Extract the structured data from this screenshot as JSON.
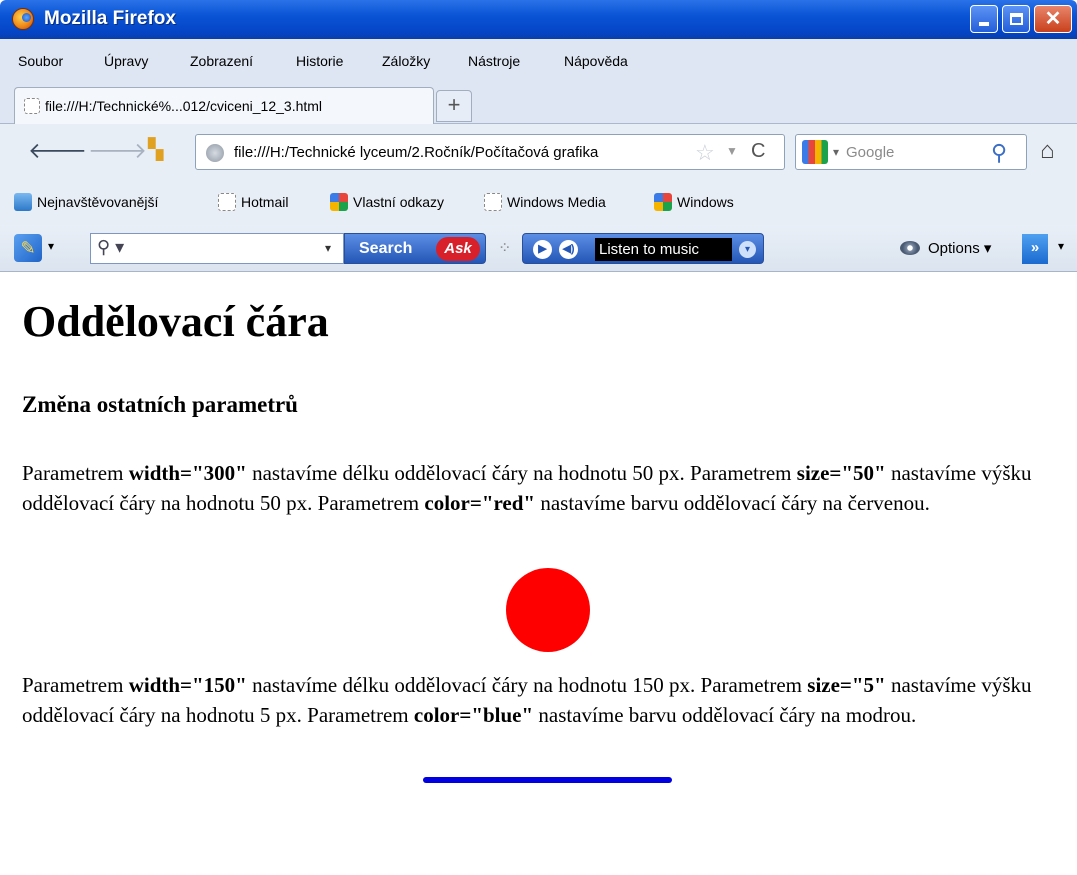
{
  "window": {
    "title": "Mozilla Firefox"
  },
  "menu": [
    "Soubor",
    "Úpravy",
    "Zobrazení",
    "Historie",
    "Záložky",
    "Nástroje",
    "Nápověda"
  ],
  "tab": {
    "label": "file:///H:/Technické%...012/cviceni_12_3.html",
    "new_tab": "+"
  },
  "nav": {
    "url": "file:///H:/Technické lyceum/2.Ročník/Počítačová grafika",
    "search_engine": "Google"
  },
  "bookmarks": [
    {
      "label": "Nejnavštěvovanější",
      "icon": "page"
    },
    {
      "label": "Hotmail",
      "icon": "dash"
    },
    {
      "label": "Vlastní odkazy",
      "icon": "win"
    },
    {
      "label": "Windows Media",
      "icon": "dash"
    },
    {
      "label": "Windows",
      "icon": "win"
    }
  ],
  "asktoolbar": {
    "search_button": "Search",
    "ask_logo": "Ask",
    "music_label": "Listen to music",
    "options": "Options"
  },
  "page": {
    "heading": "Oddělovací čára",
    "subheading": "Změna ostatních parametrů",
    "para1": {
      "t1": "Parametrem ",
      "b1": "width=\"300\"",
      "t2": " nastavíme délku oddělovací čáry na hodnotu 50 px. Parametrem ",
      "b2": "size=\"50\"",
      "t3": " nastavíme výšku oddělovací čáry na hodnotu 50 px. Parametrem ",
      "b3": "color=\"red\"",
      "t4": " nastavíme barvu oddělovací čáry na červenou."
    },
    "para2": {
      "t1": "Parametrem ",
      "b1": "width=\"150\"",
      "t2": " nastavíme délku oddělovací čáry na hodnotu 150 px. Parametrem ",
      "b2": "size=\"5\"",
      "t3": " nastavíme výšku oddělovací čáry na hodnotu 5 px. Parametrem ",
      "b3": "color=\"blue\"",
      "t4": " nastavíme barvu oddělovací čáry na modrou."
    },
    "colors": {
      "red_rule": "#ff0000",
      "blue_rule": "#0000e0"
    }
  }
}
